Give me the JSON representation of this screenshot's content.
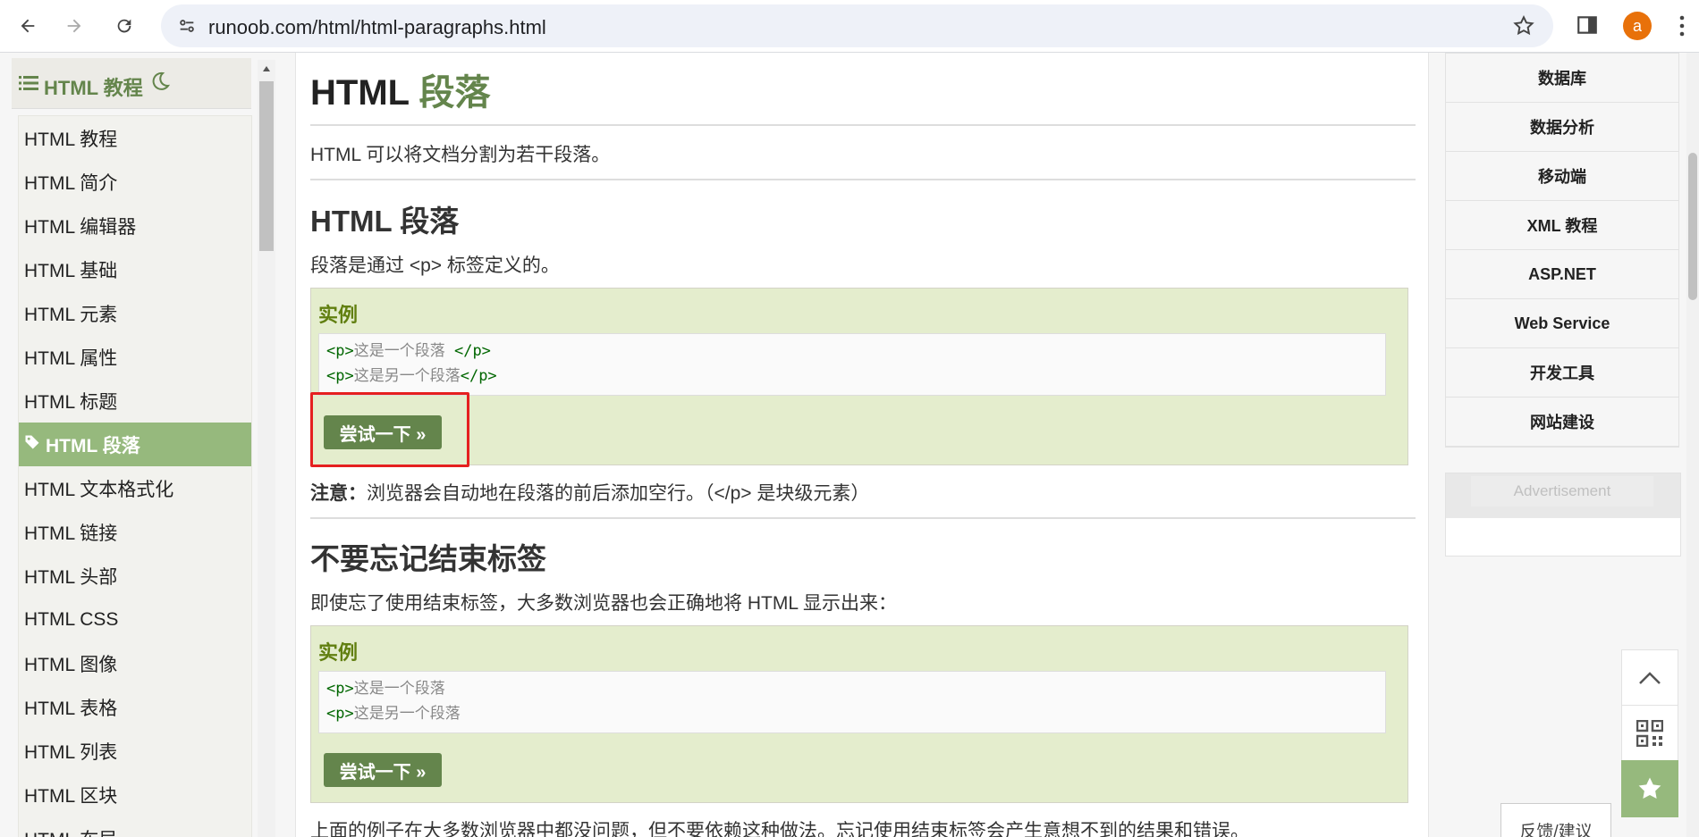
{
  "browser": {
    "url": "runoob.com/html/html-paragraphs.html",
    "avatar_letter": "a"
  },
  "sidebar": {
    "title": "HTML 教程",
    "items": [
      {
        "label": "HTML 教程"
      },
      {
        "label": "HTML 简介"
      },
      {
        "label": "HTML 编辑器"
      },
      {
        "label": "HTML 基础"
      },
      {
        "label": "HTML 元素"
      },
      {
        "label": "HTML 属性"
      },
      {
        "label": "HTML 标题"
      },
      {
        "label": "HTML 段落",
        "active": true
      },
      {
        "label": "HTML 文本格式化"
      },
      {
        "label": "HTML 链接"
      },
      {
        "label": "HTML 头部"
      },
      {
        "label": "HTML CSS"
      },
      {
        "label": "HTML 图像"
      },
      {
        "label": "HTML 表格"
      },
      {
        "label": "HTML 列表"
      },
      {
        "label": "HTML 区块"
      },
      {
        "label": "HTML 布局"
      }
    ]
  },
  "main": {
    "title_prefix": "HTML",
    "title_accent": "段落",
    "intro": "HTML 可以将文档分割为若干段落。",
    "section1": {
      "heading": "HTML 段落",
      "text": "段落是通过 <p> 标签定义的。",
      "example_title": "实例",
      "code": [
        {
          "open": "<p>",
          "content": "这是一个段落 ",
          "close": "</p>"
        },
        {
          "open": "<p>",
          "content": "这是另一个段落",
          "close": "</p>"
        }
      ],
      "try_button": "尝试一下 »",
      "note_label": "注意：",
      "note_text": "浏览器会自动地在段落的前后添加空行。（</p> 是块级元素）"
    },
    "section2": {
      "heading": "不要忘记结束标签",
      "text": "即使忘了使用结束标签，大多数浏览器也会正确地将 HTML 显示出来：",
      "example_title": "实例",
      "code": [
        {
          "open": "<p>",
          "content": "这是一个段落"
        },
        {
          "open": "<p>",
          "content": "这是另一个段落"
        }
      ],
      "try_button": "尝试一下 »",
      "bottom_text": "上面的例子在大多数浏览器中都没问题，但不要依赖这种做法。忘记使用结束标签会产生意想不到的结果和错误。"
    }
  },
  "rightcol": {
    "items": [
      "数据库",
      "数据分析",
      "移动端",
      "XML 教程",
      "ASP.NET",
      "Web Service",
      "开发工具",
      "网站建设"
    ],
    "ad_label": "Advertisement"
  },
  "feedback_label": "反馈/建议",
  "colors": {
    "brand_green": "#64854c",
    "active_item": "#96b97d",
    "example_bg": "#e4edcd",
    "highlight_red": "#e52020",
    "avatar": "#e8710a"
  }
}
